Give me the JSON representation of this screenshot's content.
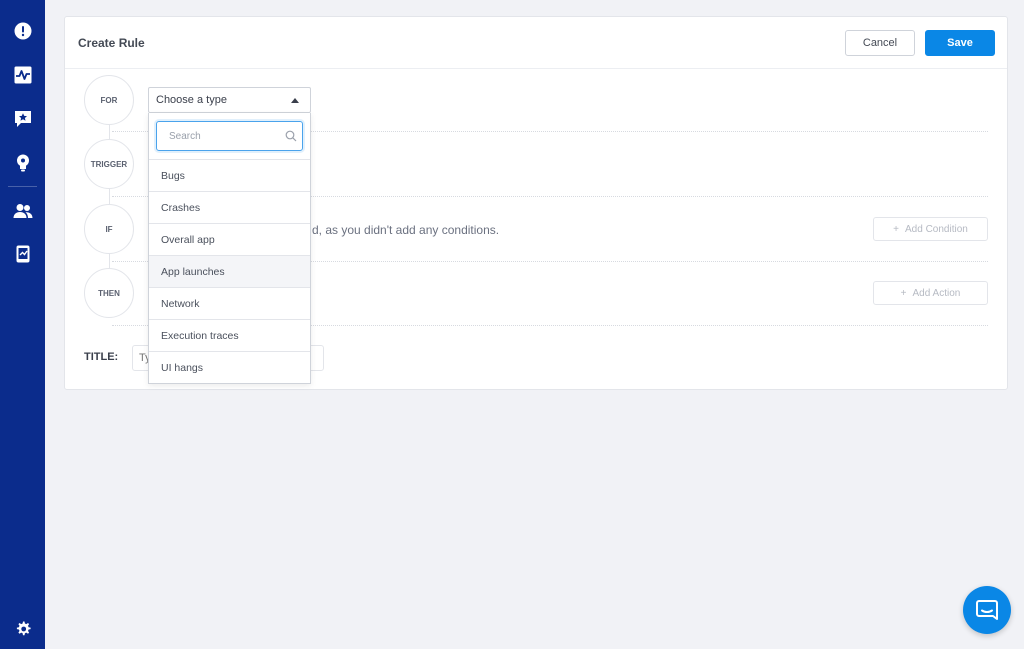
{
  "colors": {
    "sidebar": "#0b2c8c",
    "accent": "#0a87e6",
    "background": "#f1f2f6"
  },
  "sidebar": {
    "items": [
      {
        "icon": "alert-icon"
      },
      {
        "icon": "activity-icon"
      },
      {
        "icon": "feedback-star-icon"
      },
      {
        "icon": "lightbulb-icon"
      },
      {
        "icon": "users-icon"
      },
      {
        "icon": "device-icon"
      }
    ],
    "settings_icon": "gear-icon"
  },
  "header": {
    "title": "Create Rule",
    "cancel_label": "Cancel",
    "save_label": "Save"
  },
  "steps": {
    "for": "FOR",
    "trigger": "TRIGGER",
    "if": "IF",
    "then": "THEN"
  },
  "type_select": {
    "value": "Choose a type",
    "search_placeholder": "Search",
    "options": [
      "Bugs",
      "Crashes",
      "Overall app",
      "App launches",
      "Network",
      "Execution traces",
      "UI hangs"
    ]
  },
  "if_section": {
    "text": "d, as you didn't add any conditions.",
    "add_condition_label": "Add Condition"
  },
  "then_section": {
    "add_action_label": "Add Action"
  },
  "title_field": {
    "label": "TITLE:",
    "placeholder": "Ty"
  }
}
